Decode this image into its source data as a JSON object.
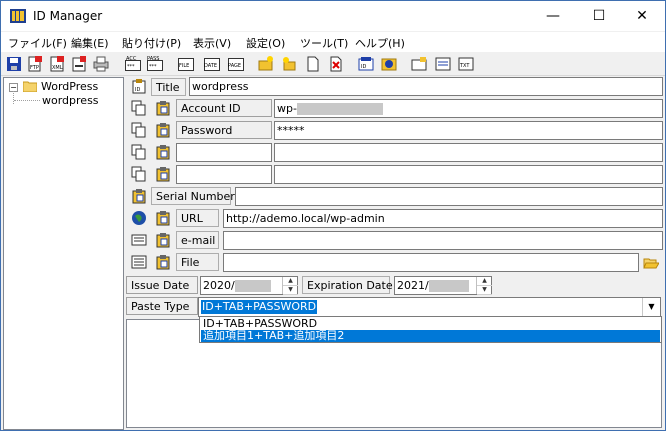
{
  "window": {
    "title": "ID Manager",
    "controls": {
      "minimize": "—",
      "maximize": "☐",
      "close": "✕"
    }
  },
  "menu": [
    "ファイル(F)",
    "編集(E)",
    "貼り付け(P)",
    "表示(V)",
    "設定(O)",
    "ツール(T)",
    "ヘルプ(H)"
  ],
  "toolbar_icons": [
    "save-icon",
    "ftp-icon",
    "xml-icon",
    "export-icon",
    "print-icon",
    "acc-icon",
    "pass-icon",
    "file-icon",
    "date-icon",
    "page-icon",
    "new-folder-icon",
    "new-item-icon",
    "new-page-icon",
    "delete-icon",
    "id-pass-icon",
    "globe-icon",
    "key-icon",
    "note-icon",
    "text-icon"
  ],
  "tree": {
    "root": "WordPress",
    "child": "wordpress"
  },
  "form": {
    "title": {
      "label": "Title",
      "value": "wordpress"
    },
    "account": {
      "label": "Account ID",
      "value": "wp-"
    },
    "password": {
      "label": "Password",
      "value": "*****"
    },
    "serial": {
      "label": "Serial Number",
      "value": ""
    },
    "url": {
      "label": "URL",
      "value": "http://ademo.local/wp-admin"
    },
    "email": {
      "label": "e-mail",
      "value": ""
    },
    "file": {
      "label": "File",
      "value": ""
    },
    "issue_date": {
      "label": "Issue Date",
      "value": "2020/"
    },
    "expiration_date": {
      "label": "Expiration Date",
      "value": "2021/"
    },
    "paste_type": {
      "label": "Paste Type",
      "selected": "ID+TAB+PASSWORD",
      "options": [
        "ID+TAB+PASSWORD",
        "追加項目1+TAB+追加項目2"
      ]
    }
  }
}
